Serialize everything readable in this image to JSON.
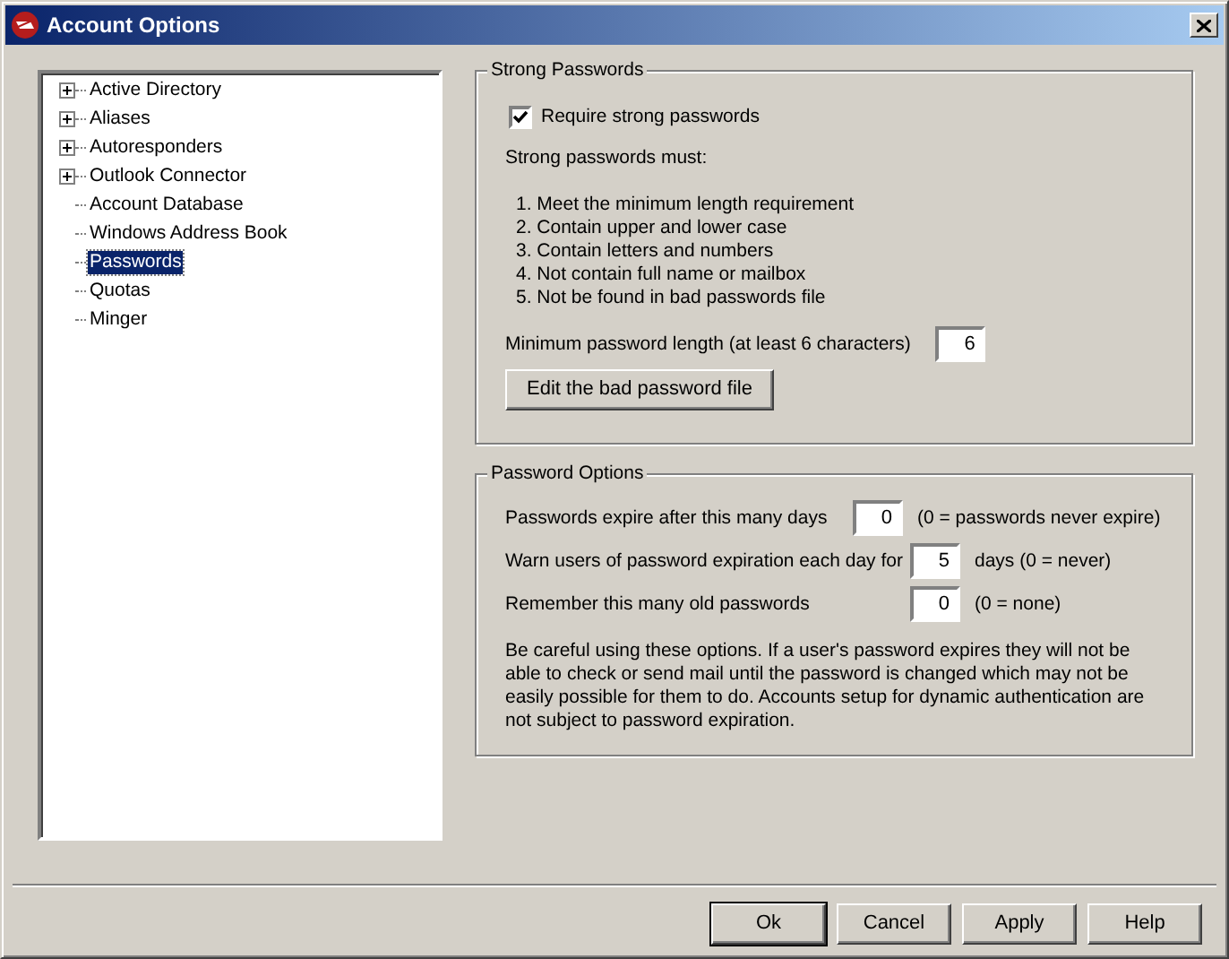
{
  "window": {
    "title": "Account Options"
  },
  "tree": [
    {
      "label": "Active Directory",
      "expandable": true,
      "selected": false
    },
    {
      "label": "Aliases",
      "expandable": true,
      "selected": false
    },
    {
      "label": "Autoresponders",
      "expandable": true,
      "selected": false
    },
    {
      "label": "Outlook Connector",
      "expandable": true,
      "selected": false
    },
    {
      "label": "Account Database",
      "expandable": false,
      "selected": false
    },
    {
      "label": "Windows Address Book",
      "expandable": false,
      "selected": false
    },
    {
      "label": "Passwords",
      "expandable": false,
      "selected": true
    },
    {
      "label": "Quotas",
      "expandable": false,
      "selected": false
    },
    {
      "label": "Minger",
      "expandable": false,
      "selected": false
    }
  ],
  "strong_passwords": {
    "title": "Strong Passwords",
    "require": {
      "label": "Require strong passwords",
      "checked": true
    },
    "intro": "Strong passwords must:",
    "rules": [
      "1. Meet the minimum length requirement",
      "2. Contain upper and lower case",
      "3. Contain letters and numbers",
      "4. Not contain full name or mailbox",
      "5. Not be found in bad passwords file"
    ],
    "min_length": {
      "label": "Minimum password length (at least 6 characters)",
      "value": "6"
    },
    "edit_button": "Edit the bad password file"
  },
  "password_options": {
    "title": "Password Options",
    "rows": [
      {
        "label": "Passwords expire after this many days",
        "value": "0",
        "hint": "(0 = passwords never expire)"
      },
      {
        "label": "Warn users of password expiration each day for",
        "value": "5",
        "hint": "days (0 = never)"
      },
      {
        "label": "Remember this many old passwords",
        "value": "0",
        "hint": "(0 = none)"
      }
    ],
    "note": "Be careful using these options.  If a user's password expires they will not be able to check or send mail until the password is changed which may not be easily possible for them to do.  Accounts setup for dynamic authentication are not subject to password expiration."
  },
  "buttons": [
    {
      "label": "Ok",
      "default": true
    },
    {
      "label": "Cancel",
      "default": false
    },
    {
      "label": "Apply",
      "default": false
    },
    {
      "label": "Help",
      "default": false
    }
  ]
}
